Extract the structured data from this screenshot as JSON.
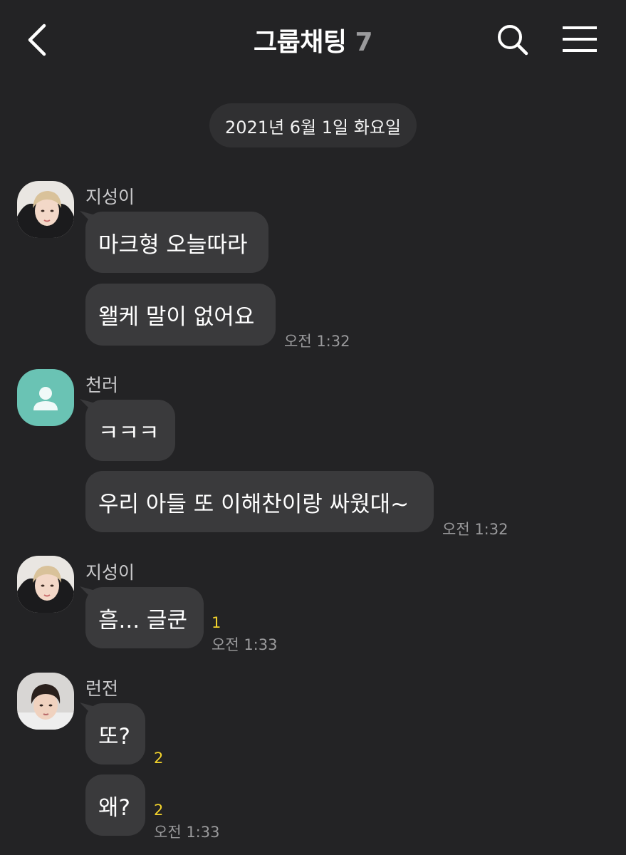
{
  "header": {
    "title": "그룹채팅",
    "member_count": "7",
    "back_icon": "chevron-left-icon",
    "search_icon": "search-icon",
    "menu_icon": "hamburger-menu-icon"
  },
  "date_divider": "2021년 6월 1일 화요일",
  "colors": {
    "background": "#232325",
    "bubble": "#3a3a3c",
    "date_pill": "#303032",
    "unread": "#f2d22c",
    "default_avatar": "#6ac3b4"
  },
  "groups": [
    {
      "sender": "지성이",
      "messages": [
        "마크형 오늘따라",
        "왤케 말이 없어요"
      ],
      "time": "오전 1:32"
    },
    {
      "sender": "천러",
      "messages": [
        "ㅋㅋㅋ",
        "우리 아들 또 이해찬이랑 싸웠대~"
      ],
      "time": "오전 1:32"
    },
    {
      "sender": "지성이",
      "messages": [
        "흠... 글쿤"
      ],
      "unread": [
        "1"
      ],
      "time": "오전 1:33"
    },
    {
      "sender": "런전",
      "messages": [
        "또?",
        "왜?"
      ],
      "unread": [
        "2",
        "2"
      ],
      "time": "오전 1:33"
    }
  ]
}
